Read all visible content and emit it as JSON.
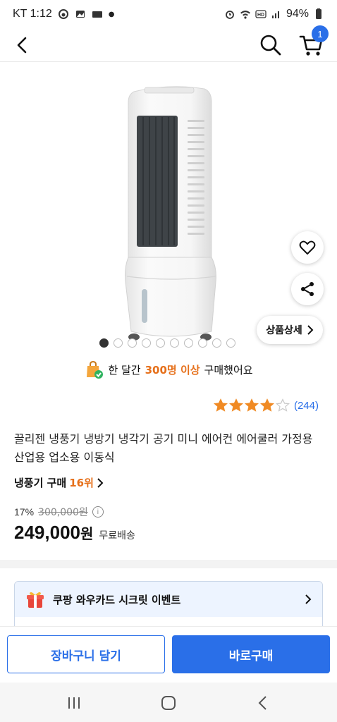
{
  "status_bar": {
    "carrier_time": "KT 1:12",
    "battery": "94%"
  },
  "nav": {
    "cart_count": "1"
  },
  "gallery": {
    "total_images": 10,
    "active_index": 0,
    "detail_button": "상품상세"
  },
  "sales": {
    "prefix": "한 달간",
    "highlight": "300명 이상",
    "suffix": "구매했어요"
  },
  "rating": {
    "stars": 4,
    "max_stars": 5,
    "count": "(244)"
  },
  "product": {
    "title": "끌리젠 냉풍기 냉방기 냉각기 공기 미니 에어컨 에어쿨러 가정용 산업용 업소용 이동식",
    "category": "냉풍기 구매",
    "rank": "16위"
  },
  "price": {
    "discount": "17%",
    "original": "300,000원",
    "sale": "249,000",
    "won": "원",
    "shipping": "무료배송"
  },
  "event": {
    "label": "쿠팡 와우카드 시크릿 이벤트"
  },
  "bottom": {
    "add_to_cart": "장바구니 담기",
    "buy_now": "바로구매"
  },
  "colors": {
    "accent": "#2a6fe8",
    "highlight": "#e6701b",
    "star": "#f08a24"
  }
}
